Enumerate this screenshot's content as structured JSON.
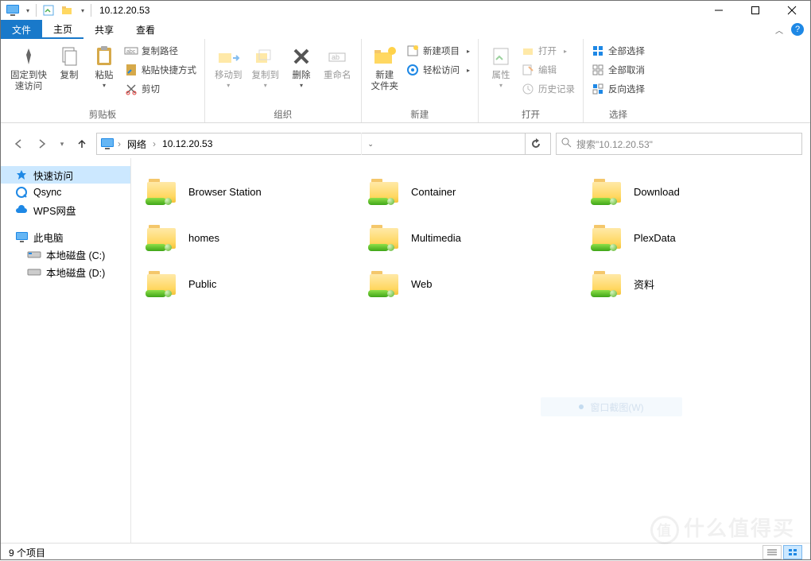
{
  "window": {
    "title": "10.12.20.53"
  },
  "tabs": {
    "file": "文件",
    "items": [
      "主页",
      "共享",
      "查看"
    ],
    "active_index": 0
  },
  "ribbon": {
    "groups": {
      "clipboard": {
        "label": "剪贴板",
        "pin": "固定到快\n速访问",
        "copy": "复制",
        "paste": "粘贴",
        "copy_path": "复制路径",
        "paste_shortcut": "粘贴快捷方式",
        "cut": "剪切"
      },
      "organize": {
        "label": "组织",
        "move_to": "移动到",
        "copy_to": "复制到",
        "delete": "删除",
        "rename": "重命名"
      },
      "new": {
        "label": "新建",
        "new_folder": "新建\n文件夹",
        "new_item": "新建项目",
        "easy_access": "轻松访问"
      },
      "open": {
        "label": "打开",
        "properties": "属性",
        "open": "打开",
        "edit": "编辑",
        "history": "历史记录"
      },
      "select": {
        "label": "选择",
        "select_all": "全部选择",
        "select_none": "全部取消",
        "invert": "反向选择"
      }
    }
  },
  "addressbar": {
    "root": "网络",
    "current": "10.12.20.53"
  },
  "search": {
    "placeholder": "搜索\"10.12.20.53\""
  },
  "sidebar": {
    "quick_access": "快速访问",
    "qsync": "Qsync",
    "wps": "WPS网盘",
    "this_pc": "此电脑",
    "drive_c": "本地磁盘 (C:)",
    "drive_d": "本地磁盘 (D:)"
  },
  "folders": [
    "Browser Station",
    "Container",
    "Download",
    "homes",
    "Multimedia",
    "PlexData",
    "Public",
    "Web",
    "资料"
  ],
  "ghost": {
    "label": "窗口截图(W)"
  },
  "statusbar": {
    "count": "9 个项目"
  },
  "watermark": {
    "text": "什么值得买"
  }
}
